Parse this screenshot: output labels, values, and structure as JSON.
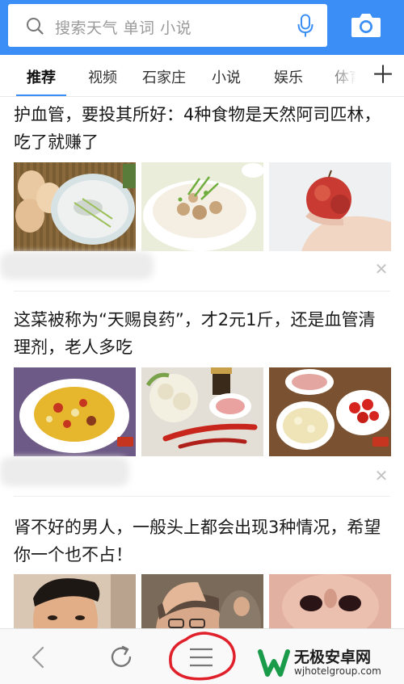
{
  "search": {
    "placeholder": "搜索天气 单词 小说"
  },
  "tabs": [
    {
      "label": "推荐",
      "active": true
    },
    {
      "label": "视频"
    },
    {
      "label": "石家庄"
    },
    {
      "label": "小说"
    },
    {
      "label": "娱乐"
    },
    {
      "label": "体育"
    }
  ],
  "add_tab_icon": "plus-icon",
  "articles": [
    {
      "title": "护血管，要投其所好：4种食物是天然阿司匹林，吃了就赚了",
      "thumbnails": [
        "eggs-and-rice-porridge",
        "meatball-congee",
        "hand-holding-apple"
      ]
    },
    {
      "title": "这菜被称为“天赐良药”，才2元1斤，还是血管清理剂，老人多吃",
      "thumbnails": [
        "stir-fried-cauliflower-with-peppers",
        "raw-cauliflower-and-red-chili",
        "cauliflower-meat-tomato-bowls"
      ]
    },
    {
      "title": "肾不好的男人，一般头上都会出现3种情况，希望你一个也不占！",
      "thumbnails": [
        "young-man-face",
        "man-holding-head",
        "nose-closeup"
      ]
    }
  ],
  "bottom_nav": {
    "back_icon": "back-arrow-icon",
    "refresh_icon": "refresh-icon",
    "menu_icon": "menu-icon",
    "menu_highlight_color": "#e0202a"
  },
  "watermark": {
    "title": "无极安卓网",
    "url": "wjhotelgroup.com"
  },
  "colors": {
    "accent": "#3a8ef6",
    "watermark_green": "#1a9b4a"
  }
}
